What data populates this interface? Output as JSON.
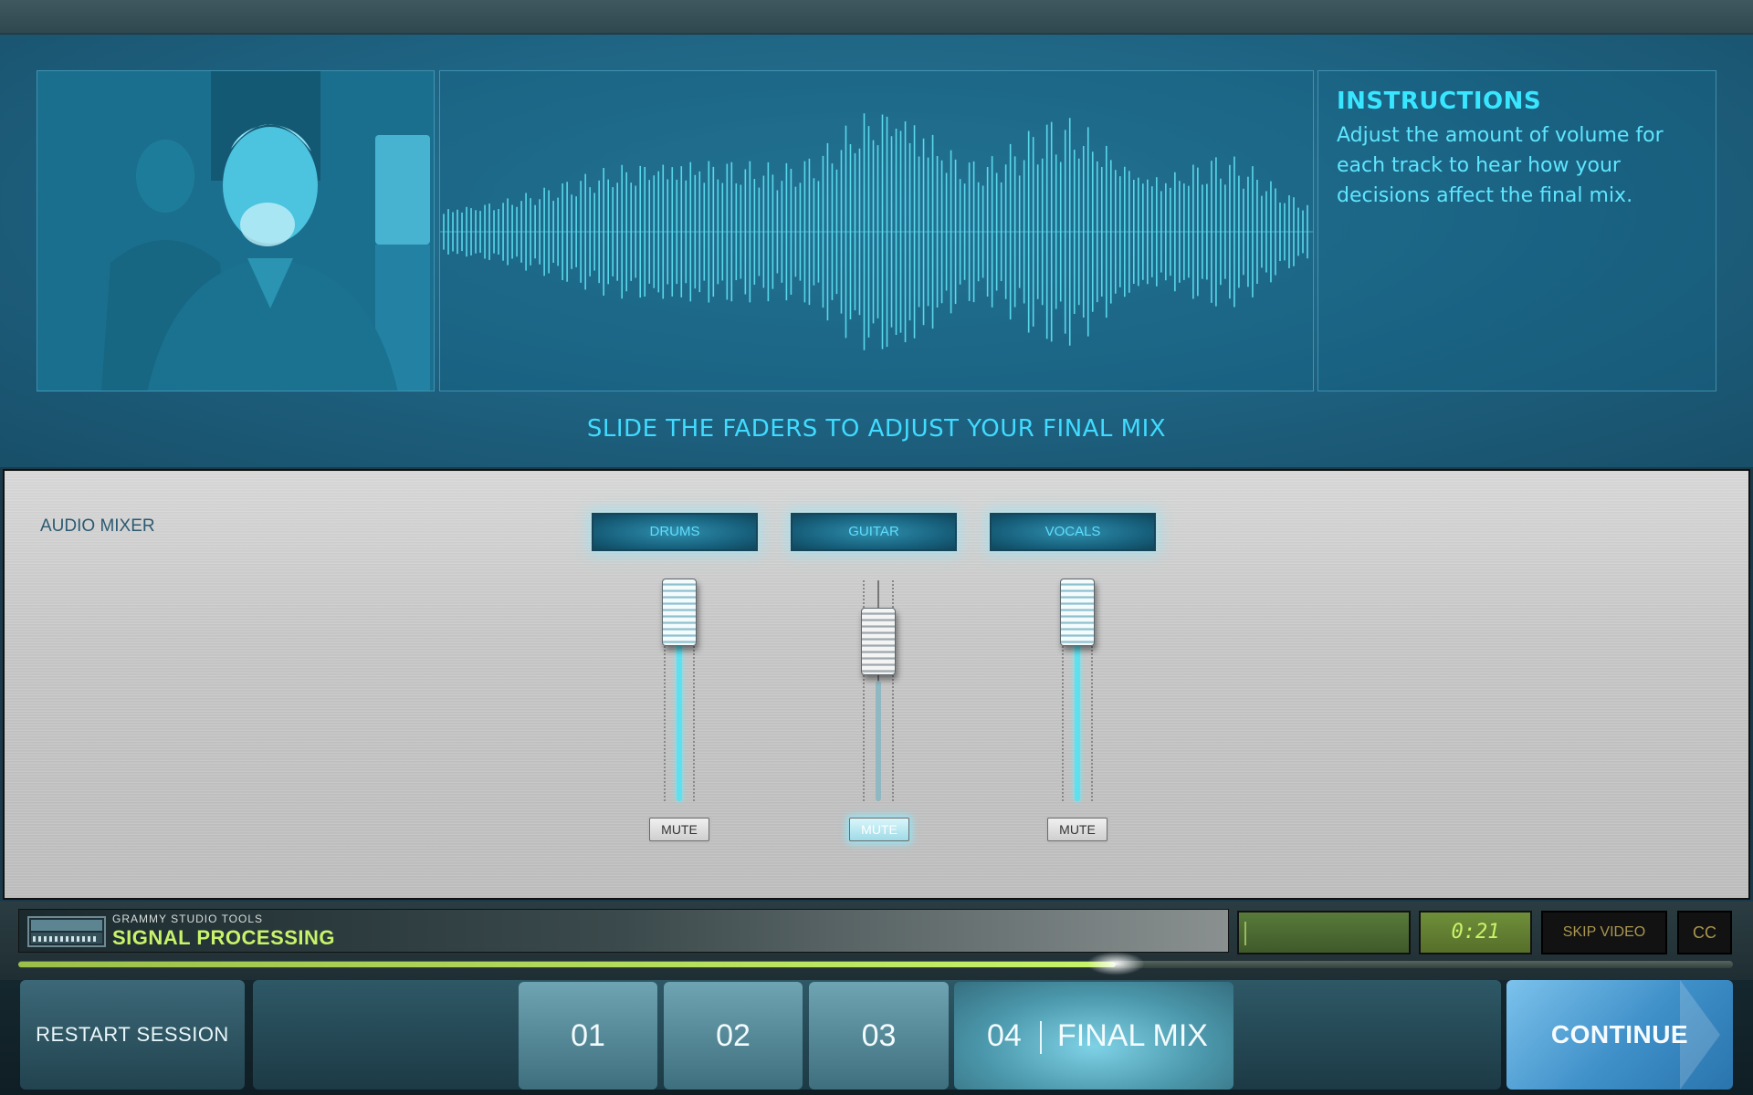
{
  "instructions": {
    "title": "INSTRUCTIONS",
    "body": "Adjust the amount of volume for each track to hear how your decisions affect the final mix."
  },
  "caption": "SLIDE THE FADERS TO ADJUST YOUR FINAL MIX",
  "mixer": {
    "label": "AUDIO MIXER",
    "channels": [
      {
        "name": "DRUMS",
        "mute_label": "MUTE",
        "level": 0.98,
        "muted": false
      },
      {
        "name": "GUITAR",
        "mute_label": "MUTE",
        "level": 0.86,
        "muted": true
      },
      {
        "name": "VOCALS",
        "mute_label": "MUTE",
        "level": 0.98,
        "muted": false
      }
    ]
  },
  "player": {
    "brand_sub": "GRAMMY STUDIO TOOLS",
    "brand_title": "SIGNAL PROCESSING",
    "time": "0:21",
    "skip_label": "SKIP VIDEO",
    "cc_label": "CC",
    "progress": 0.64
  },
  "nav": {
    "restart_label": "RESTART SESSION",
    "steps": [
      "01",
      "02",
      "03"
    ],
    "active_step_number": "04",
    "active_step_name": "FINAL MIX",
    "continue_label": "CONTINUE"
  },
  "colors": {
    "accent": "#38e6ff",
    "brand_green": "#c8f36a",
    "stage_blue": "#1e6281"
  },
  "video": {
    "subject": "person-video-frame"
  }
}
